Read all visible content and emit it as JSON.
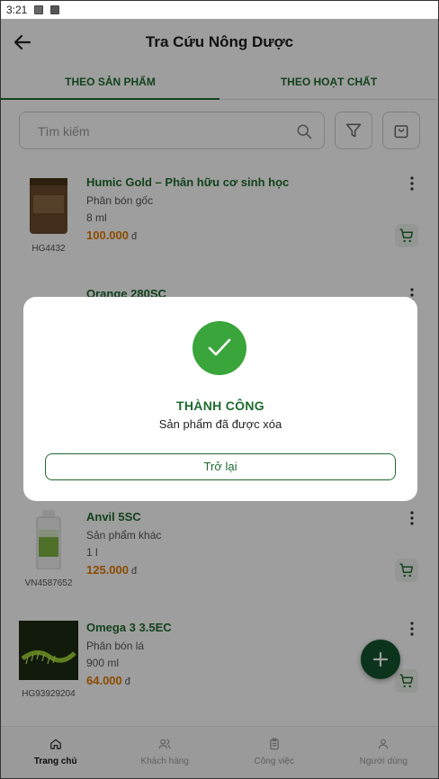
{
  "status_bar": {
    "time": "3:21"
  },
  "header": {
    "title": "Tra Cứu Nông Dược",
    "back_icon": "arrow-left-icon"
  },
  "tabs": [
    {
      "label": "THEO SẢN PHẨM",
      "active": true
    },
    {
      "label": "THEO HOẠT CHẤT",
      "active": false
    }
  ],
  "search": {
    "placeholder": "Tìm kiếm"
  },
  "products": [
    {
      "name": "Humic Gold – Phân hữu cơ sinh học",
      "category": "Phân bón gốc",
      "quantity": "8 ml",
      "price": "100.000",
      "currency": "đ",
      "code": "HG4432"
    },
    {
      "name": "Orange 280SC",
      "category": "",
      "quantity": "",
      "price": "",
      "currency": "",
      "code": ""
    },
    {
      "name": "Anvil 5SC",
      "category": "Sản phẩm khác",
      "quantity": "1 l",
      "price": "125.000",
      "currency": "đ",
      "code": "VN4587652"
    },
    {
      "name": "Omega 3 3.5EC",
      "category": "Phân bón lá",
      "quantity": "900 ml",
      "price": "64.000",
      "currency": "đ",
      "code": "HG93929204"
    }
  ],
  "bottom_nav": [
    {
      "label": "Trang chủ",
      "icon": "home-icon",
      "active": true
    },
    {
      "label": "Khách hàng",
      "icon": "user-group-icon",
      "active": false
    },
    {
      "label": "Công việc",
      "icon": "clipboard-icon",
      "active": false
    },
    {
      "label": "Người dùng",
      "icon": "person-icon",
      "active": false
    }
  ],
  "dialog": {
    "title": "THÀNH CÔNG",
    "message": "Sản phẩm đã được xóa",
    "button_label": "Trở lại",
    "icon": "checkmark-icon"
  },
  "colors": {
    "brand_green": "#1d6b2e",
    "price_orange": "#e07a00",
    "success_green": "#3aa53a",
    "fab_green": "#14532d"
  }
}
